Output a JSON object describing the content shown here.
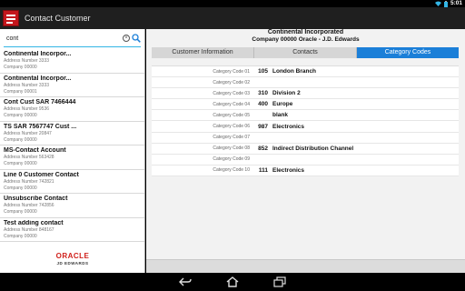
{
  "status": {
    "time": "5:01"
  },
  "app": {
    "title": "Contact Customer"
  },
  "search": {
    "value": "cont"
  },
  "contacts": [
    {
      "name": "Continental Incorpor...",
      "address": "Address Number 3333",
      "company": "Company 00000"
    },
    {
      "name": "Continental Incorpor...",
      "address": "Address Number 3333",
      "company": "Company 00001"
    },
    {
      "name": "Cont Cust SAR 7466444",
      "address": "Address Number 9536",
      "company": "Company 00000"
    },
    {
      "name": "TS SAR 7567747 Cust ...",
      "address": "Address Number 20847",
      "company": "Company 00000"
    },
    {
      "name": "MS-Contact Account",
      "address": "Address Number 563428",
      "company": "Company 00000"
    },
    {
      "name": "Line 0 Customer Contact",
      "address": "Address Number 742821",
      "company": "Company 00000"
    },
    {
      "name": "Unsubscribe Contact",
      "address": "Address Number 742856",
      "company": "Company 00000"
    },
    {
      "name": "Test adding contact",
      "address": "Address Number 848167",
      "company": "Company 00000"
    }
  ],
  "logo": {
    "brand": "ORACLE",
    "product": "JD EDWARDS"
  },
  "detail": {
    "title": "Continental Incorporated",
    "subtitle": "Company 00000  Oracle - J.D. Edwards"
  },
  "tabs": [
    {
      "label": "Customer Information"
    },
    {
      "label": "Contacts"
    },
    {
      "label": "Category Codes"
    }
  ],
  "category_codes": [
    {
      "label": "Category Code 01",
      "value": "105",
      "description": "London Branch"
    },
    {
      "label": "Category Code 02",
      "value": "",
      "description": ""
    },
    {
      "label": "Category Code 03",
      "value": "310",
      "description": "Division 2"
    },
    {
      "label": "Category Code 04",
      "value": "400",
      "description": "Europe"
    },
    {
      "label": "Category Code 05",
      "value": "",
      "description": "blank"
    },
    {
      "label": "Category Code 06",
      "value": "987",
      "description": "Electronics"
    },
    {
      "label": "Category Code 07",
      "value": "",
      "description": ""
    },
    {
      "label": "Category Code 08",
      "value": "852",
      "description": "Indirect Distribution Channel"
    },
    {
      "label": "Category Code 09",
      "value": "",
      "description": ""
    },
    {
      "label": "Category Code 10",
      "value": "111",
      "description": "Electronics"
    }
  ],
  "colors": {
    "accent": "#1b7fd8",
    "search_underline": "#33b5e5",
    "brand_red": "#c4161c"
  }
}
